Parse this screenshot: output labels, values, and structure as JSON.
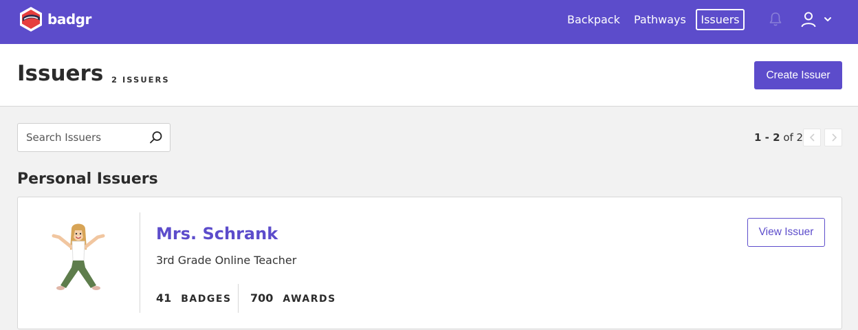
{
  "brand": {
    "name": "badgr",
    "primary_color": "#5c4ccb"
  },
  "nav": {
    "items": [
      {
        "label": "Backpack"
      },
      {
        "label": "Pathways"
      },
      {
        "label": "Issuers",
        "active": true
      }
    ],
    "icons": [
      "bell-icon",
      "user-icon",
      "chevron-down-icon"
    ]
  },
  "header": {
    "title": "Issuers",
    "count": "2 ISSUERS",
    "create_label": "Create Issuer"
  },
  "search": {
    "placeholder": "Search Issuers",
    "value": ""
  },
  "pagination": {
    "range": "1 - 2",
    "of": "of 2"
  },
  "section": {
    "title": "Personal Issuers"
  },
  "issuers": [
    {
      "name": "Mrs. Schrank",
      "description": "3rd Grade Online Teacher",
      "badges_count": "41",
      "badges_label": "BADGES",
      "awards_count": "700",
      "awards_label": "AWARDS",
      "view_label": "View Issuer"
    }
  ]
}
